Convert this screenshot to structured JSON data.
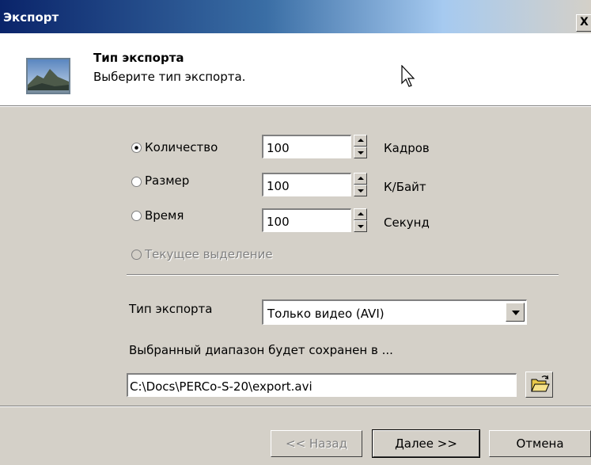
{
  "window": {
    "title": "Экспорт",
    "close_label": "X"
  },
  "header": {
    "title": "Тип экспорта",
    "subtitle": "Выберите тип экспорта.",
    "icon": "landscape-picture-icon"
  },
  "options": [
    {
      "label": "Количество",
      "value": "100",
      "unit": "Кадров",
      "selected": true,
      "enabled": true
    },
    {
      "label": "Размер",
      "value": "100",
      "unit": "К/Байт",
      "selected": false,
      "enabled": true
    },
    {
      "label": "Время",
      "value": "100",
      "unit": "Секунд",
      "selected": false,
      "enabled": true
    },
    {
      "label": "Текущее выделение",
      "selected": false,
      "enabled": false
    }
  ],
  "export_type": {
    "label": "Тип экспорта",
    "value": "Только видео (AVI)"
  },
  "destination": {
    "label": "Выбранный диапазон будет сохранен в ...",
    "path": "C:\\Docs\\PERCo-S-20\\export.avi",
    "browse_icon": "open-folder-icon"
  },
  "buttons": {
    "back": "<< Назад",
    "next": "Далее >>",
    "cancel": "Отмена"
  },
  "colors": {
    "titlebar_start": "#0a246a",
    "face": "#d4d0c8",
    "disabled_text": "#808080"
  }
}
